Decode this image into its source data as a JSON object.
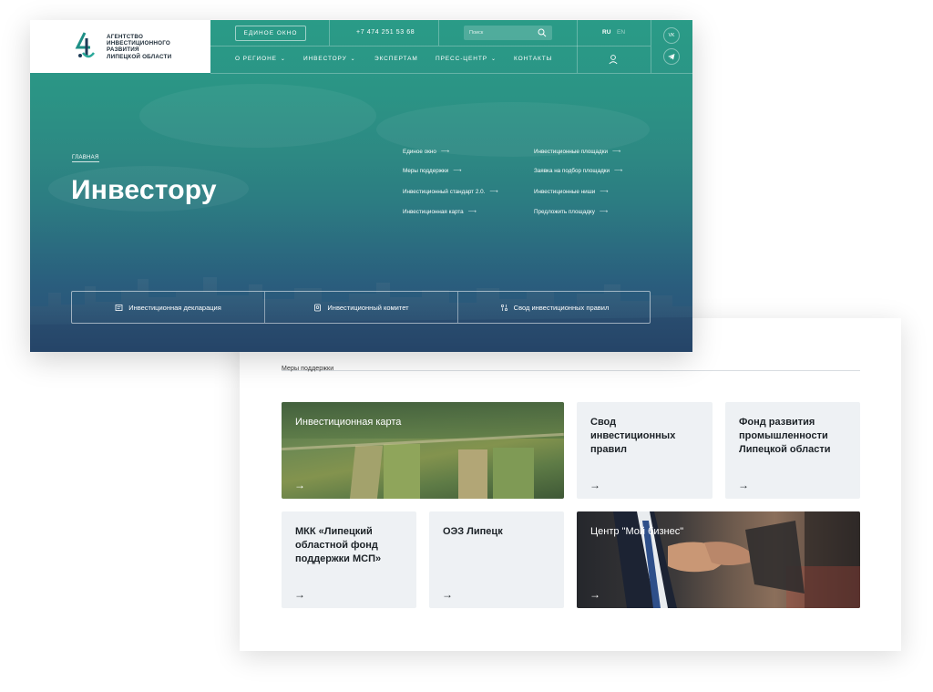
{
  "header": {
    "logo_text": [
      "АГЕНТСТВО",
      "ИНВЕСТИЦИОННОГО",
      "РАЗВИТИЯ",
      "ЛИПЕЦКОЙ ОБЛАСТИ"
    ],
    "window_button": "ЕДИНОЕ ОКНО",
    "phone": "+7 474 251 53 68",
    "search_placeholder": "Поиск",
    "lang_ru": "RU",
    "lang_en": "EN",
    "social_vk": "VK",
    "nav": [
      "О РЕГИОНЕ",
      "ИНВЕСТОРУ",
      "ЭКСПЕРТАМ",
      "ПРЕСС-ЦЕНТР",
      "КОНТАКТЫ"
    ]
  },
  "hero": {
    "breadcrumb": "ГЛАВНАЯ",
    "title": "Инвестору",
    "links_left": [
      "Единое окно",
      "Меры поддержки",
      "Инвестиционный стандарт 2.0.",
      "Инвестиционная карта"
    ],
    "links_right": [
      "Инвестиционные площадки",
      "Заявка на подбор площадки",
      "Инвестиционные ниши",
      "Предложить площадку"
    ],
    "bottom_items": [
      "Инвестиционная декларация",
      "Инвестиционный комитет",
      "Свод инвестиционных правил"
    ]
  },
  "support": {
    "breadcrumb": "Меры поддержки",
    "tiles": [
      "Инвестиционная карта",
      "Свод инвестиционных правил",
      "Фонд развития промышленности Липецкой области",
      "МКК «Липецкий областной фонд поддержки МСП»",
      "ОЭЗ Липецк",
      "Центр \"Мой бизнес\""
    ],
    "arrow": "→"
  },
  "colors": {
    "teal": "#2a9b87",
    "navy": "#294f75",
    "tile_bg": "#eef1f4"
  }
}
